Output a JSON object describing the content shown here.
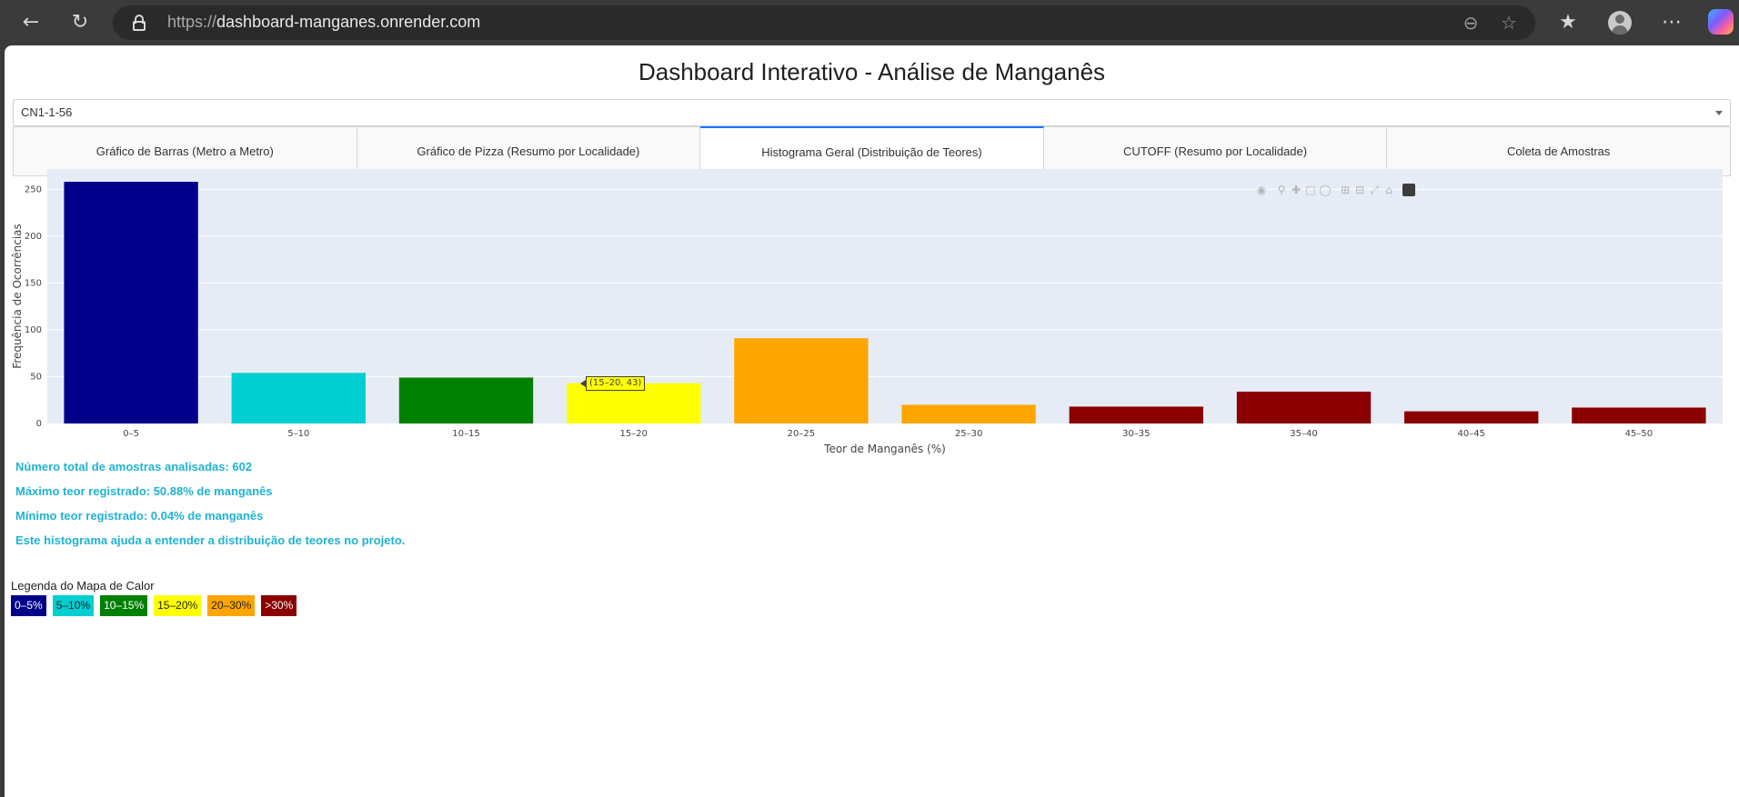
{
  "browser": {
    "url_scheme": "https://",
    "url_host": "dashboard-manganes.onrender.com"
  },
  "page": {
    "title": "Dashboard Interativo - Análise de Manganês",
    "selector_value": "CN1-1-56",
    "tabs": [
      {
        "label": "Gráfico de Barras (Metro a Metro)",
        "active": false
      },
      {
        "label": "Gráfico de Pizza (Resumo por Localidade)",
        "active": false
      },
      {
        "label": "Histograma Geral (Distribuição de Teores)",
        "active": true
      },
      {
        "label": "CUTOFF (Resumo por Localidade)",
        "active": false
      },
      {
        "label": "Coleta de Amostras",
        "active": false
      }
    ],
    "stats": [
      "Número total de amostras analisadas: 602",
      "Máximo teor registrado: 50.88% de manganês",
      "Mínimo teor registrado: 0.04% de manganês",
      "Este histograma ajuda a entender a distribuição de teores no projeto."
    ],
    "legend_title": "Legenda do Mapa de Calor",
    "legend": [
      {
        "label": "0–5%",
        "color": "#00008b",
        "text_color": "#ffffff"
      },
      {
        "label": "5–10%",
        "color": "#00ced1",
        "text_color": "#1f1f1f"
      },
      {
        "label": "10–15%",
        "color": "#008000",
        "text_color": "#ffffff"
      },
      {
        "label": "15–20%",
        "color": "#ffff00",
        "text_color": "#1f1f1f"
      },
      {
        "label": "20–30%",
        "color": "#ffa500",
        "text_color": "#1f1f1f"
      },
      {
        "label": ">30%",
        "color": "#8b0000",
        "text_color": "#ffffff"
      }
    ],
    "hover_label": "(15–20, 43)"
  },
  "chart_data": {
    "type": "bar",
    "xlabel": "Teor de Manganês (%)",
    "ylabel": "Frequência de Ocorrências",
    "categories": [
      "0–5",
      "5–10",
      "10–15",
      "15–20",
      "20–25",
      "25–30",
      "30–35",
      "35–40",
      "40–45",
      "45–50"
    ],
    "values": [
      258,
      54,
      49,
      43,
      91,
      20,
      18,
      34,
      13,
      17
    ],
    "colors": [
      "#00008b",
      "#00ced1",
      "#008000",
      "#ffff00",
      "#ffa500",
      "#ffa500",
      "#8b0000",
      "#8b0000",
      "#8b0000",
      "#8b0000"
    ],
    "ylim": [
      0,
      271.6
    ],
    "yticks": [
      0,
      50,
      100,
      150,
      200,
      250
    ],
    "plot_bg": "#e5ecf6",
    "grid": true
  }
}
